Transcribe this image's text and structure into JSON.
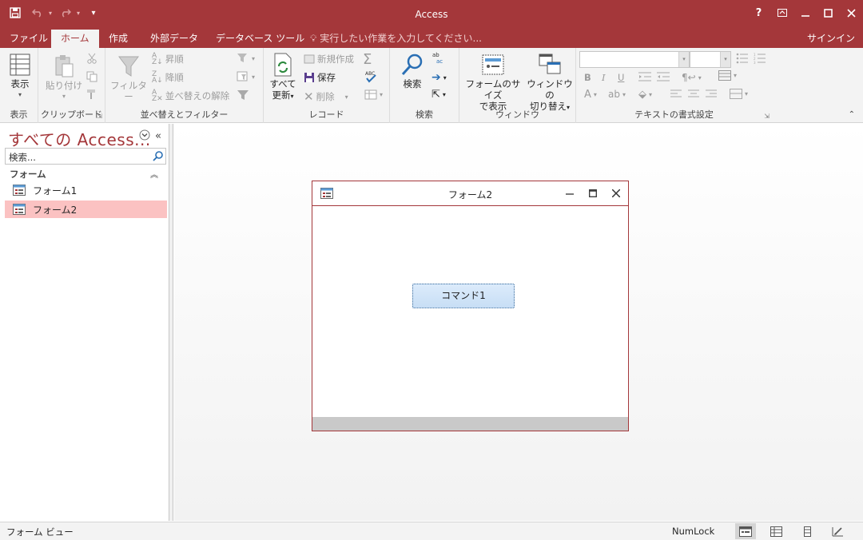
{
  "window": {
    "title": "Access",
    "help": "?"
  },
  "menu": {
    "tabs": [
      "ファイル",
      "ホーム",
      "作成",
      "外部データ",
      "データベース ツール"
    ],
    "tell_me": "実行したい作業を入力してください...",
    "sign_in": "サインイン"
  },
  "ribbon": {
    "groups": {
      "view": {
        "label": "表示",
        "button": "表示"
      },
      "clipboard": {
        "label": "クリップボード",
        "paste": "貼り付け"
      },
      "sort_filter": {
        "label": "並べ替えとフィルター",
        "filter": "フィルター",
        "ascending": "昇順",
        "descending": "降順",
        "clear_sort": "並べ替えの解除"
      },
      "records": {
        "label": "レコード",
        "refresh_line1": "すべて",
        "refresh_line2": "更新",
        "new": "新規作成",
        "save": "保存",
        "delete": "削除"
      },
      "find": {
        "label": "検索",
        "button": "検索"
      },
      "window": {
        "label": "ウィンドウ",
        "fit_line1": "フォームのサイズ",
        "fit_line2": "で表示",
        "switch_line1": "ウィンドウの",
        "switch_line2": "切り替え"
      },
      "text_format": {
        "label": "テキストの書式設定",
        "bold": "B",
        "italic": "I",
        "underline": "U",
        "font_color": "A"
      }
    }
  },
  "nav_pane": {
    "header": "すべての Access...",
    "search_placeholder": "検索...",
    "group": "フォーム",
    "items": [
      {
        "label": "フォーム1",
        "selected": false
      },
      {
        "label": "フォーム2",
        "selected": true
      }
    ]
  },
  "form_window": {
    "title": "フォーム2",
    "command_button": "コマンド1"
  },
  "status_bar": {
    "mode": "フォーム ビュー",
    "numlock": "NumLock"
  },
  "colors": {
    "accent": "#a4373a",
    "selected_item": "#fbc2c2",
    "command_button": "#c7def5"
  }
}
